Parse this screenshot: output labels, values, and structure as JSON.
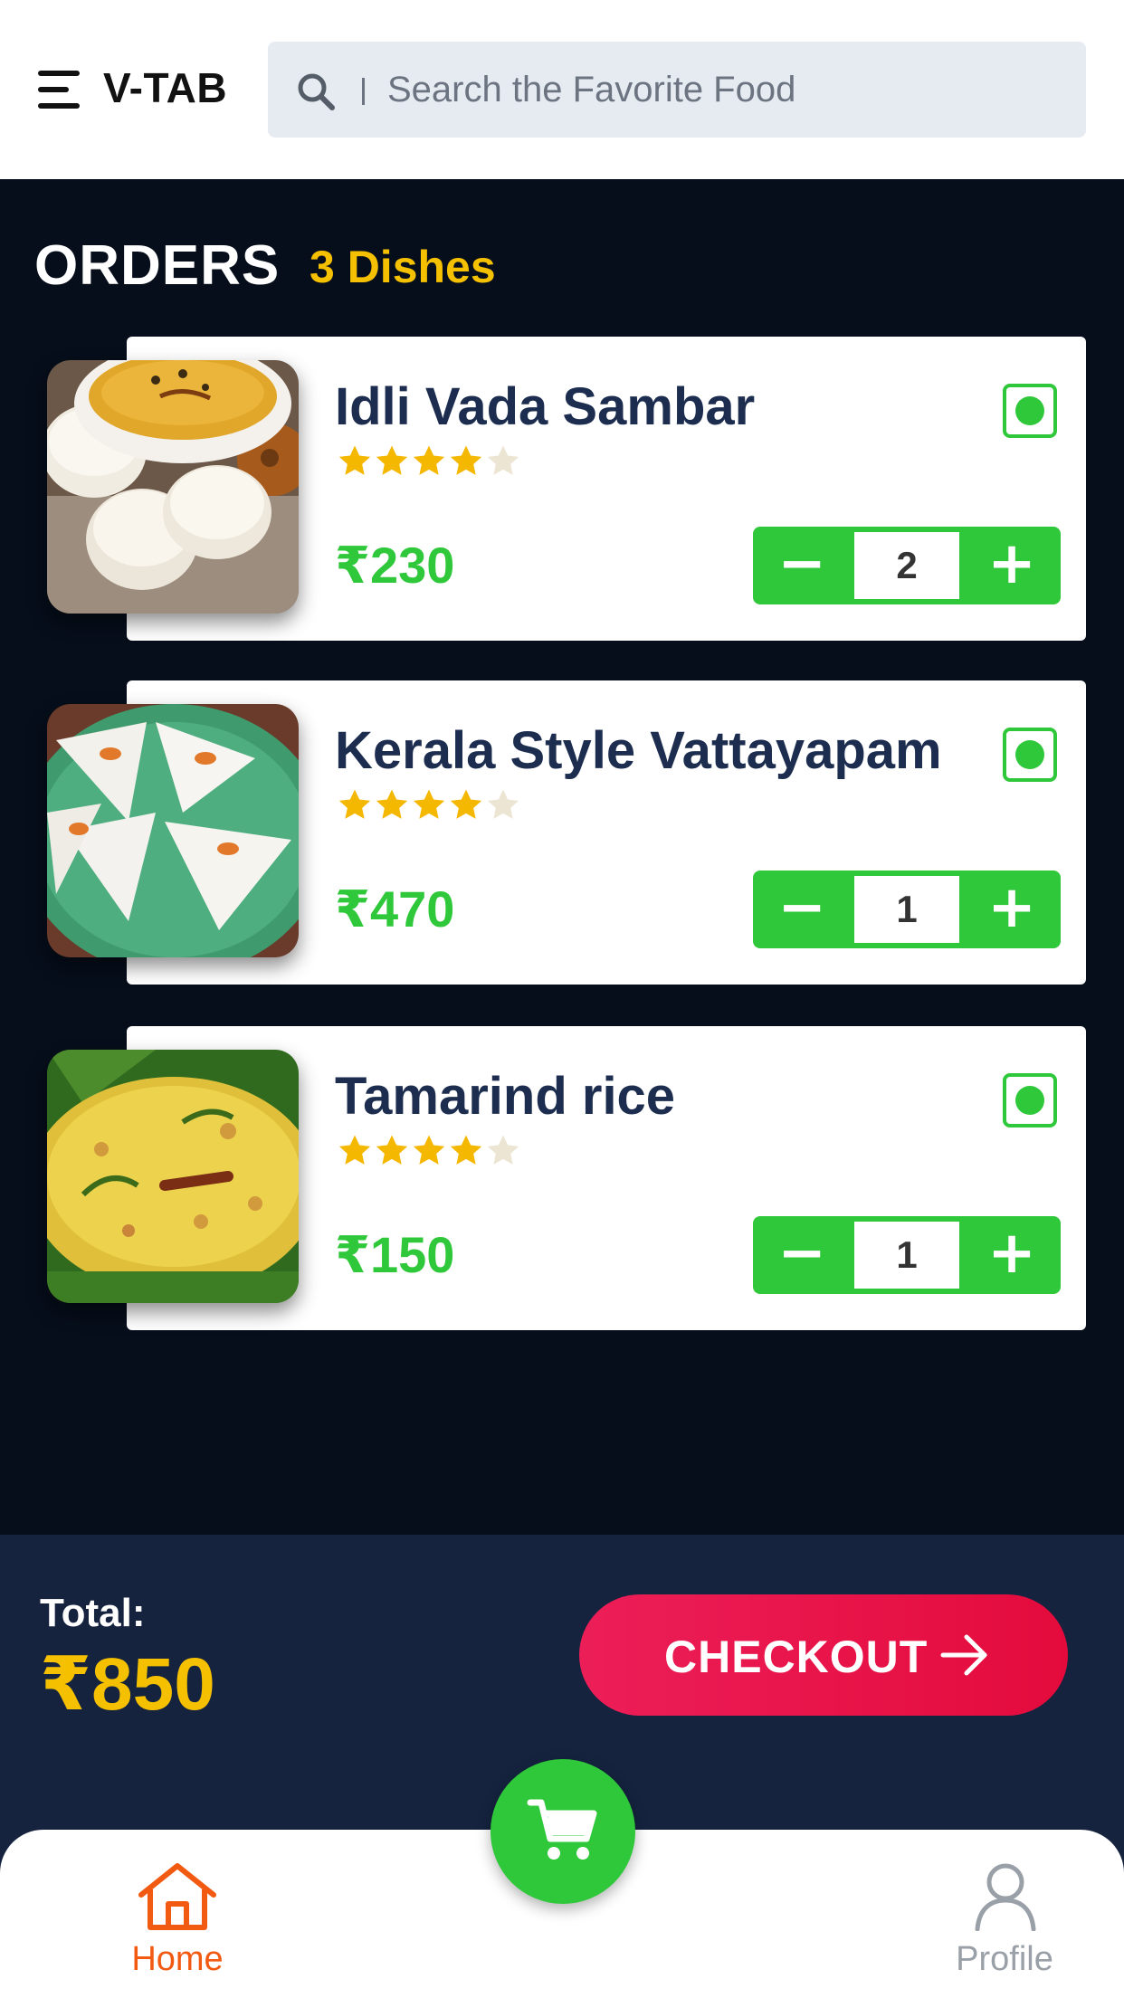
{
  "header": {
    "brand": "V-TAB",
    "search_placeholder": "Search the Favorite Food"
  },
  "orders": {
    "title": "ORDERS",
    "count_label": "3 Dishes",
    "items": [
      {
        "name": "Idli Vada Sambar",
        "price": "₹230",
        "quantity": "2",
        "rating": 4,
        "rating_max": 5,
        "image": "idli-vada-sambar-photo",
        "veg": true
      },
      {
        "name": "Kerala Style Vattayapam",
        "price": "₹470",
        "quantity": "1",
        "rating": 4,
        "rating_max": 5,
        "image": "vattayapam-photo",
        "veg": true
      },
      {
        "name": "Tamarind rice",
        "price": "₹150",
        "quantity": "1",
        "rating": 4,
        "rating_max": 5,
        "image": "tamarind-rice-photo",
        "veg": true
      }
    ]
  },
  "summary": {
    "total_label": "Total:",
    "total_amount": "₹850",
    "checkout_label": "CHECKOUT"
  },
  "nav": {
    "home_label": "Home",
    "profile_label": "Profile"
  },
  "colors": {
    "background": "#060e1b",
    "accent_green": "#2fc83a",
    "accent_yellow": "#f5c000",
    "checkout_red": "#e8144a",
    "home_orange": "#f25a12",
    "dish_name": "#1c2d4f"
  },
  "icons": [
    "menu-icon",
    "search-icon",
    "star-icon",
    "veg-indicator-icon",
    "arrow-right-icon",
    "home-icon",
    "cart-icon",
    "profile-icon"
  ]
}
